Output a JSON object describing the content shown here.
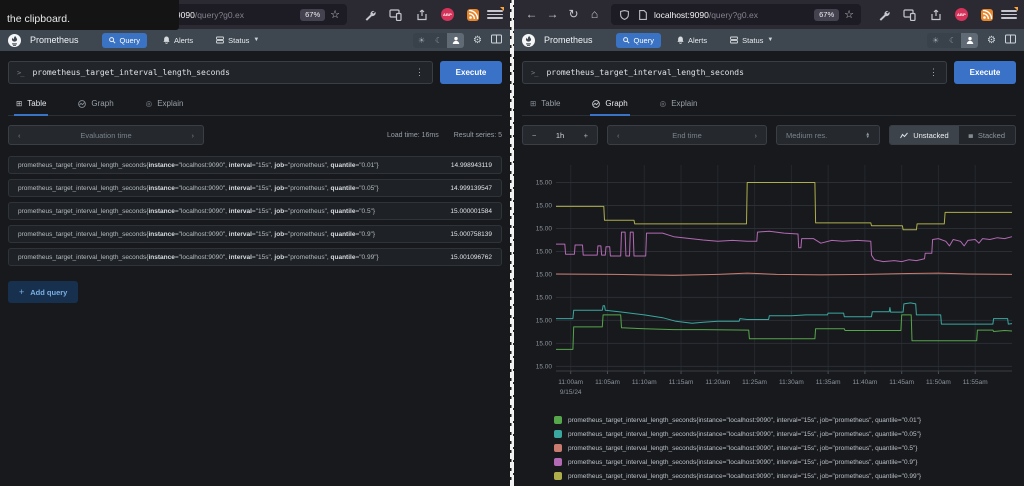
{
  "browser": {
    "tooltip_text": "the clipboard.",
    "url_host": "localhost:9090",
    "url_path": "/query?g0.ex",
    "zoom_badge": "67%",
    "abp_label": "ABP"
  },
  "app": {
    "name": "Prometheus",
    "nav_query": "Query",
    "nav_alerts": "Alerts",
    "nav_status": "Status"
  },
  "query_panel": {
    "query": "prometheus_target_interval_length_seconds",
    "execute": "Execute",
    "tabs": {
      "table": "Table",
      "graph": "Graph",
      "explain": "Explain"
    }
  },
  "table_view": {
    "eval_time_placeholder": "Evaluation time",
    "load_time": "Load time: 16ms",
    "result_series": "Result series: 5",
    "add_query": "Add query",
    "rows": [
      {
        "metric": "prometheus_target_interval_length_seconds",
        "labels": [
          [
            "instance",
            "localhost:9090"
          ],
          [
            "interval",
            "15s"
          ],
          [
            "job",
            "prometheus"
          ],
          [
            "quantile",
            "0.01"
          ]
        ],
        "value": "14.998943119"
      },
      {
        "metric": "prometheus_target_interval_length_seconds",
        "labels": [
          [
            "instance",
            "localhost:9090"
          ],
          [
            "interval",
            "15s"
          ],
          [
            "job",
            "prometheus"
          ],
          [
            "quantile",
            "0.05"
          ]
        ],
        "value": "14.999139547"
      },
      {
        "metric": "prometheus_target_interval_length_seconds",
        "labels": [
          [
            "instance",
            "localhost:9090"
          ],
          [
            "interval",
            "15s"
          ],
          [
            "job",
            "prometheus"
          ],
          [
            "quantile",
            "0.5"
          ]
        ],
        "value": "15.000001584"
      },
      {
        "metric": "prometheus_target_interval_length_seconds",
        "labels": [
          [
            "instance",
            "localhost:9090"
          ],
          [
            "interval",
            "15s"
          ],
          [
            "job",
            "prometheus"
          ],
          [
            "quantile",
            "0.9"
          ]
        ],
        "value": "15.000758139"
      },
      {
        "metric": "prometheus_target_interval_length_seconds",
        "labels": [
          [
            "instance",
            "localhost:9090"
          ],
          [
            "interval",
            "15s"
          ],
          [
            "job",
            "prometheus"
          ],
          [
            "quantile",
            "0.99"
          ]
        ],
        "value": "15.001096762"
      }
    ]
  },
  "graph_view": {
    "range": "1h",
    "end_time_placeholder": "End time",
    "resolution": "Medium res.",
    "unstacked": "Unstacked",
    "stacked": "Stacked"
  },
  "chart_data": {
    "type": "line",
    "title": "prometheus_target_interval_length_seconds",
    "grid": true,
    "legend_position": "bottom",
    "x_axis": {
      "range_minutes": [
        0,
        62
      ],
      "tick_minutes": [
        2,
        7,
        12,
        17,
        22,
        27,
        32,
        37,
        42,
        47,
        52,
        57
      ],
      "tick_labels": [
        "11:00am",
        "11:05am",
        "11:10am",
        "11:15am",
        "11:20am",
        "11:25am",
        "11:30am",
        "11:35am",
        "11:40am",
        "11:45am",
        "11:50am",
        "11:55am"
      ],
      "date_label": "9/15/24"
    },
    "y_axis": {
      "range": [
        14.9979,
        15.00238
      ],
      "tick_label": "15.00",
      "gridline_values": [
        14.998,
        14.9985,
        14.999,
        14.9995,
        15.0,
        15.0005,
        15.001,
        15.0015,
        15.002
      ]
    },
    "series": [
      {
        "name": "quantile=\"0.01\"",
        "color": "#56a64b",
        "points": [
          [
            0,
            14.99837
          ],
          [
            2.3,
            14.99837
          ],
          [
            2.4,
            14.99886
          ],
          [
            6.3,
            14.99886
          ],
          [
            6.4,
            14.99912
          ],
          [
            8.8,
            14.99912
          ],
          [
            8.9,
            14.99884
          ],
          [
            12,
            14.99882
          ],
          [
            16,
            14.9988
          ],
          [
            20,
            14.9988
          ],
          [
            26.2,
            14.99879
          ],
          [
            26.3,
            14.9986
          ],
          [
            35.2,
            14.9986
          ],
          [
            35.3,
            14.99882
          ],
          [
            39.2,
            14.99882
          ],
          [
            39.3,
            14.99878
          ],
          [
            46.9,
            14.99878
          ],
          [
            47,
            14.99912
          ],
          [
            48.3,
            14.99912
          ],
          [
            48.4,
            14.99856
          ],
          [
            57.2,
            14.99856
          ],
          [
            57.3,
            14.99879
          ],
          [
            59.4,
            14.99879
          ],
          [
            59.5,
            14.99876
          ],
          [
            61,
            14.99878
          ],
          [
            62,
            14.99877
          ]
        ]
      },
      {
        "name": "quantile=\"0.05\"",
        "color": "#3aa8a0",
        "points": [
          [
            0,
            14.99904
          ],
          [
            2.3,
            14.99904
          ],
          [
            2.4,
            14.99922
          ],
          [
            6.3,
            14.99922
          ],
          [
            6.4,
            14.99932
          ],
          [
            6.6,
            14.99932
          ],
          [
            6.7,
            14.99922
          ],
          [
            9,
            14.99918
          ],
          [
            12,
            14.99912
          ],
          [
            14.5,
            14.99906
          ],
          [
            16.3,
            14.99898
          ],
          [
            18.5,
            14.99894
          ],
          [
            20,
            14.99896
          ],
          [
            22,
            14.99898
          ],
          [
            24.9,
            14.99898
          ],
          [
            25,
            14.99904
          ],
          [
            26,
            14.99902
          ],
          [
            28.9,
            14.99902
          ],
          [
            29,
            14.9991
          ],
          [
            32,
            14.9991
          ],
          [
            34,
            14.99912
          ],
          [
            36.9,
            14.99912
          ],
          [
            37,
            14.99916
          ],
          [
            39.1,
            14.99916
          ],
          [
            39.2,
            14.99908
          ],
          [
            42.9,
            14.99908
          ],
          [
            43,
            14.99919
          ],
          [
            45.3,
            14.99919
          ],
          [
            45.4,
            14.99928
          ],
          [
            45.5,
            14.99918
          ],
          [
            47.2,
            14.99918
          ],
          [
            47.3,
            14.99936
          ],
          [
            48.2,
            14.99938
          ],
          [
            48.9,
            14.99936
          ],
          [
            49,
            14.99912
          ],
          [
            52.3,
            14.99912
          ],
          [
            52.4,
            14.99892
          ],
          [
            59.4,
            14.99892
          ],
          [
            59.5,
            14.99904
          ],
          [
            61.4,
            14.99904
          ],
          [
            61.5,
            14.99892
          ],
          [
            62,
            14.99893
          ]
        ]
      },
      {
        "name": "quantile=\"0.5\"",
        "color": "#c97b70",
        "points": [
          [
            0,
            15.00001
          ],
          [
            8,
            15.0
          ],
          [
            16,
            14.99998
          ],
          [
            22,
            15.0
          ],
          [
            26,
            15.00003
          ],
          [
            30,
            15.0
          ],
          [
            36,
            14.99999
          ],
          [
            42,
            15.0
          ],
          [
            48,
            15.00002
          ],
          [
            52,
            15.00003
          ],
          [
            56,
            15.00001
          ],
          [
            62,
            15.0
          ]
        ]
      },
      {
        "name": "quantile=\"0.9\"",
        "color": "#b469b4",
        "points": [
          [
            0,
            15.00066
          ],
          [
            1.2,
            15.00066
          ],
          [
            1.3,
            15.00044
          ],
          [
            2.5,
            15.00044
          ],
          [
            2.6,
            15.00064
          ],
          [
            3.6,
            15.00064
          ],
          [
            3.7,
            15.00042
          ],
          [
            5.6,
            15.00042
          ],
          [
            5.7,
            15.00062
          ],
          [
            6.1,
            15.00062
          ],
          [
            6.2,
            15.00042
          ],
          [
            6.7,
            15.00042
          ],
          [
            6.8,
            15.0006
          ],
          [
            7.3,
            15.0006
          ],
          [
            7.4,
            15.0004
          ],
          [
            8.8,
            15.0004
          ],
          [
            8.9,
            15.00092
          ],
          [
            9.4,
            15.00092
          ],
          [
            9.5,
            15.0004
          ],
          [
            10,
            15.0004
          ],
          [
            10.1,
            15.00092
          ],
          [
            10.5,
            15.00092
          ],
          [
            10.6,
            15.0004
          ],
          [
            12.2,
            15.0004
          ],
          [
            12.3,
            15.0009
          ],
          [
            14.5,
            15.0009
          ],
          [
            16,
            15.00082
          ],
          [
            20,
            15.00075
          ],
          [
            22,
            15.00072
          ],
          [
            24,
            15.00074
          ],
          [
            26,
            15.00072
          ],
          [
            27.3,
            15.00072
          ],
          [
            27.4,
            15.00092
          ],
          [
            29,
            15.00094
          ],
          [
            31,
            15.0009
          ],
          [
            32.9,
            15.00088
          ],
          [
            33,
            15.00058
          ],
          [
            33.3,
            15.00058
          ],
          [
            33.4,
            15.00078
          ],
          [
            35,
            15.00078
          ],
          [
            36,
            15.00068
          ],
          [
            37.5,
            15.00074
          ],
          [
            39,
            15.00072
          ],
          [
            41,
            15.00074
          ],
          [
            42.8,
            15.00072
          ],
          [
            42.9,
            15.00042
          ],
          [
            43.3,
            15.00032
          ],
          [
            44.5,
            15.00028
          ],
          [
            46,
            15.0003
          ],
          [
            47,
            15.00028
          ],
          [
            48,
            15.00032
          ],
          [
            49,
            15.0003
          ],
          [
            50.1,
            15.00034
          ],
          [
            50.2,
            15.00046
          ],
          [
            51.1,
            15.00046
          ],
          [
            51.2,
            15.00076
          ],
          [
            52,
            15.00078
          ],
          [
            53,
            15.00072
          ],
          [
            53.5,
            15.00062
          ],
          [
            54,
            15.00076
          ],
          [
            55,
            15.00072
          ],
          [
            55.5,
            15.00062
          ],
          [
            56,
            15.00074
          ],
          [
            57,
            15.00076
          ],
          [
            57.5,
            15.00068
          ],
          [
            58,
            15.00078
          ],
          [
            59,
            15.00076
          ],
          [
            60,
            15.0008
          ],
          [
            61,
            15.00078
          ],
          [
            62,
            15.00082
          ]
        ]
      },
      {
        "name": "quantile=\"0.99\"",
        "color": "#aeae4a",
        "points": [
          [
            0,
            15.00148
          ],
          [
            6.5,
            15.00148
          ],
          [
            6.6,
            15.00118
          ],
          [
            10.6,
            15.00118
          ],
          [
            10.7,
            15.0011
          ],
          [
            25.9,
            15.0011
          ],
          [
            26,
            15.002
          ],
          [
            35.2,
            15.002
          ],
          [
            35.3,
            15.00112
          ],
          [
            42.8,
            15.00112
          ],
          [
            42.9,
            15.00106
          ],
          [
            47.1,
            15.00106
          ],
          [
            47.2,
            15.00097
          ],
          [
            49,
            15.00097
          ],
          [
            49.1,
            15.0011
          ],
          [
            52.8,
            15.0011
          ],
          [
            52.9,
            15.00135
          ],
          [
            62,
            15.00135
          ]
        ]
      }
    ],
    "legend": [
      {
        "color": "#56a64b",
        "label": "prometheus_target_interval_length_seconds{instance=\"localhost:9090\", interval=\"15s\", job=\"prometheus\", quantile=\"0.01\"}"
      },
      {
        "color": "#3aa8a0",
        "label": "prometheus_target_interval_length_seconds{instance=\"localhost:9090\", interval=\"15s\", job=\"prometheus\", quantile=\"0.05\"}"
      },
      {
        "color": "#c97b70",
        "label": "prometheus_target_interval_length_seconds{instance=\"localhost:9090\", interval=\"15s\", job=\"prometheus\", quantile=\"0.5\"}"
      },
      {
        "color": "#b469b4",
        "label": "prometheus_target_interval_length_seconds{instance=\"localhost:9090\", interval=\"15s\", job=\"prometheus\", quantile=\"0.9\"}"
      },
      {
        "color": "#aeae4a",
        "label": "prometheus_target_interval_length_seconds{instance=\"localhost:9090\", interval=\"15s\", job=\"prometheus\", quantile=\"0.99\"}"
      }
    ]
  }
}
